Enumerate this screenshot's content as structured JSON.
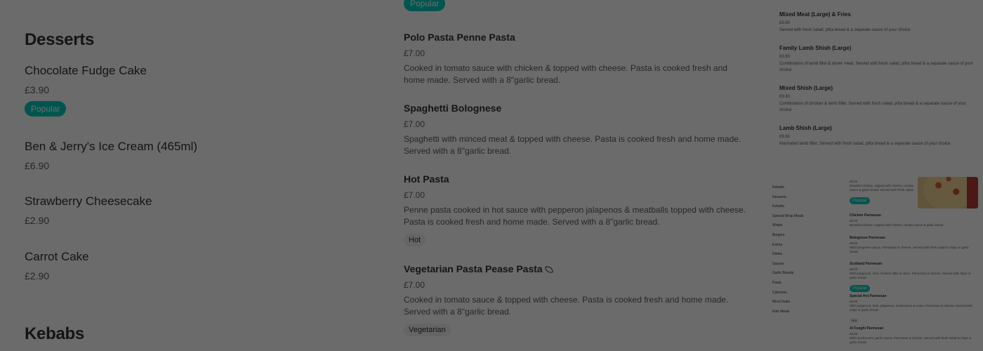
{
  "panel1": {
    "categories": [
      {
        "title": "Desserts"
      },
      {
        "title": "Kebabs"
      }
    ],
    "items": [
      {
        "name": "Chocolate Fudge Cake",
        "price": "£3.90",
        "tag": "Popular"
      },
      {
        "name": "Ben & Jerry's Ice Cream (465ml)",
        "price": "£6.90"
      },
      {
        "name": "Strawberry Cheesecake",
        "price": "£2.90"
      },
      {
        "name": "Carrot Cake",
        "price": "£2.90"
      }
    ]
  },
  "panel2": {
    "top_tag": "Popular",
    "items": [
      {
        "name": "Polo Pasta Penne Pasta",
        "price": "£7.00",
        "desc": "Cooked in tomato sauce with chicken & topped with cheese. Pasta is cooked fresh and home made. Served with a 8\"garlic bread."
      },
      {
        "name": "Spaghetti Bolognese",
        "price": "£7.00",
        "desc": "Spaghetti with minced meat & topped with cheese. Pasta is cooked fresh and home made. Served with a 8\"garlic bread."
      },
      {
        "name": "Hot Pasta",
        "price": "£7.00",
        "desc": "Penne pasta cooked in hot sauce with pepperon jalapenos & meatballs topped with cheese. Pasta is cooked fresh and home made. Served with a 8\"garlic bread.",
        "tag": "Hot"
      },
      {
        "name": "Vegetarian Pasta Pease Pasta",
        "price": "£7.00",
        "desc": "Cooked in tomato sauce & topped with cheese. Pasta is cooked fresh and home made. Served with a 8\"garlic bread.",
        "tag": "Vegetarian",
        "icon": "leaf-icon"
      }
    ]
  },
  "panel3": {
    "items": [
      {
        "name": "Mixed Meat (Large) & Fries",
        "price": "£9.60",
        "desc": "Served with fresh salad, pitta bread & a separate sauce of your choice"
      },
      {
        "name": "Family Lamb Shish (Large)",
        "price": "£9.60",
        "desc": "Combination of lamb fillet & doner meat. Served with fresh salad, pitta bread & a separate sauce of your choice"
      },
      {
        "name": "Mixed Shish (Large)",
        "price": "£9.60",
        "desc": "Combination of chicken & lamb fillet. Served with fresh salad, pitta bread & a separate sauce of your choice"
      },
      {
        "name": "Lamb Shish (Large)",
        "price": "£9.60",
        "desc": "Marinated lamb fillet. Served with fresh salad, pitta bread & a separate sauce of your choice"
      }
    ]
  },
  "panel4": {
    "nav": [
      "Kebabs",
      "Desserts",
      "Kebabs",
      "Special Wrap Meals",
      "Wraps",
      "Burgers",
      "Extras",
      "Drinks",
      "Sauces",
      "Garlic Breads",
      "Pasta",
      "Calzones",
      "Meal Deals",
      "Kids Meals"
    ],
    "top_price": "£8.00",
    "top_desc": "Breaded chicken, topped with cheese, tomato sauce & garlic bread. Served with fresh salad.",
    "top_tag": "Popular",
    "items": [
      {
        "name": "Chicken Parmesan",
        "price": "£8.00",
        "desc": "Breaded chicken, topped with cheese, tomato sauce & garlic bread."
      },
      {
        "name": "Bolognese Parmesan",
        "price": "£8.00",
        "desc": "With bolognese sauce, Parmesan & cheese. Served with fresh salad & chips or garlic bread."
      },
      {
        "name": "Scotland Parmesan",
        "price": "£8.00",
        "desc": "With pepperoni, ham, chicken tikka & onion. Parmesan & cheese. Served with chips or garlic bread.",
        "tag": "Popular"
      },
      {
        "name": "Special Hot Parmesan",
        "price": "£8.00",
        "desc": "With pepperoni, ham, jalapenos, mushrooms & onion, Parmesan & cheese. Served with chips or garlic bread.",
        "tag": "Hot"
      },
      {
        "name": "Al Funghi Parmesan",
        "price": "£8.00",
        "desc": "With mushrooms, garlic sauce, Parmesan & cheese. Served with fresh salad & chips or garlic bread."
      }
    ]
  },
  "colors": {
    "accent": "#00ccbc",
    "text": "#2e3333",
    "muted": "#585c5c"
  }
}
